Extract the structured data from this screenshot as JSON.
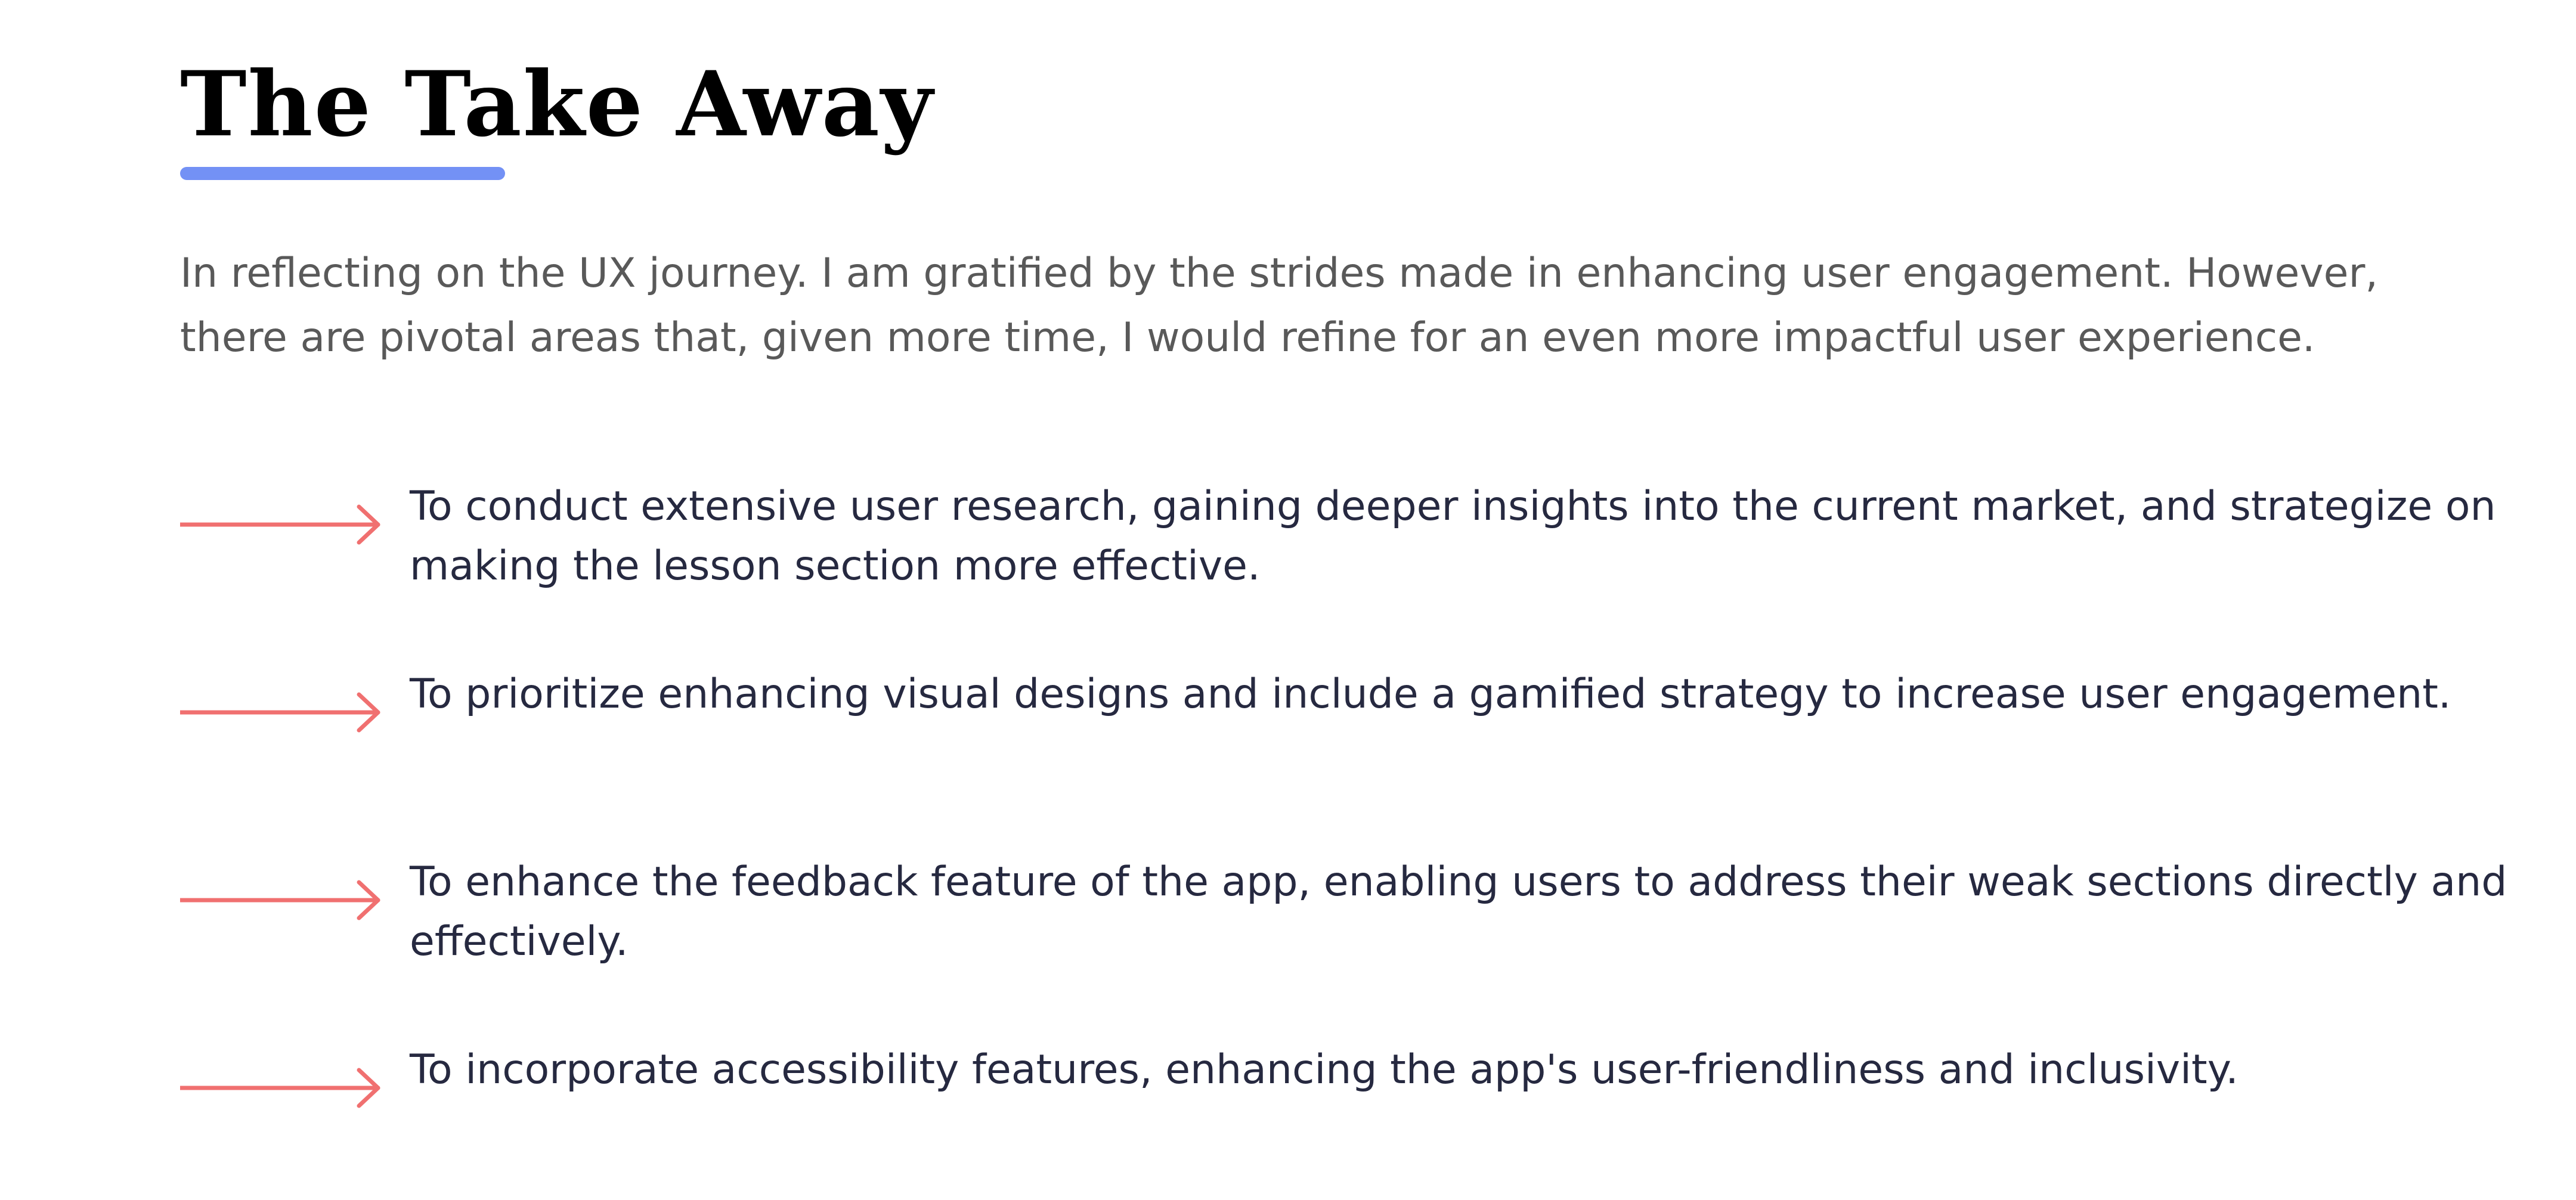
{
  "section": {
    "title": "The Take Away",
    "intro": "In reflecting on the UX journey. I am gratified by the strides made in enhancing user engagement. However, there are pivotal areas that, given more time, I would refine for an even more impactful user experience.",
    "points": [
      {
        "icon": "arrow-right-icon",
        "text": "To conduct extensive user research, gaining deeper insights into the current market, and strategize on making the lesson section more effective."
      },
      {
        "icon": "arrow-right-icon",
        "text": "To prioritize enhancing visual designs and include a gamified strategy to increase user engagement."
      },
      {
        "icon": "arrow-right-icon",
        "text": "To enhance the feedback feature of the app, enabling users to address their weak sections directly and effectively."
      },
      {
        "icon": "arrow-right-icon",
        "text": "To incorporate accessibility features, enhancing the app's user-friendliness and inclusivity."
      }
    ]
  },
  "colors": {
    "title": "#000000",
    "underline_accent": "#7391f5",
    "intro_text": "#595959",
    "point_text": "#262940",
    "arrow": "#f07070"
  }
}
